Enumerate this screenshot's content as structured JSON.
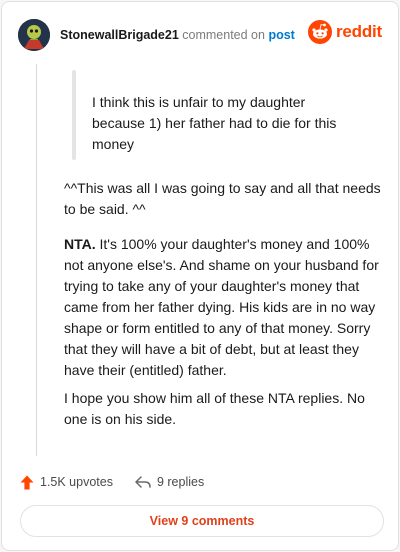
{
  "header": {
    "username": "StonewallBrigade21",
    "commented_on": "commented on",
    "post_link": "post",
    "brand": "reddit"
  },
  "colors": {
    "brand": "#ff4500",
    "link": "#0079d3",
    "view_button_text": "#e0401b"
  },
  "comment": {
    "quote": "I think this is unfair to my daughter because 1) her father had to die for this money",
    "paragraph1": "^^This was all I was going to say and all that needs to be said. ^^",
    "paragraph2_lead": "NTA.",
    "paragraph2_body": " It's 100% your daughter's money and 100% not anyone else's. And shame on your husband for trying to take any of your daughter's money that came from her father dying. His kids are in no way shape or form entitled to any of that money. Sorry that they will have a bit of debt, but at least they have their (entitled) father.",
    "paragraph3": "I hope you show him all of these NTA replies. No one is on his side."
  },
  "actions": {
    "upvotes": "1.5K upvotes",
    "replies": "9 replies",
    "upvote_icon": "upvote-arrow-icon",
    "reply_icon": "reply-arrow-icon"
  },
  "view_button": "View 9 comments"
}
